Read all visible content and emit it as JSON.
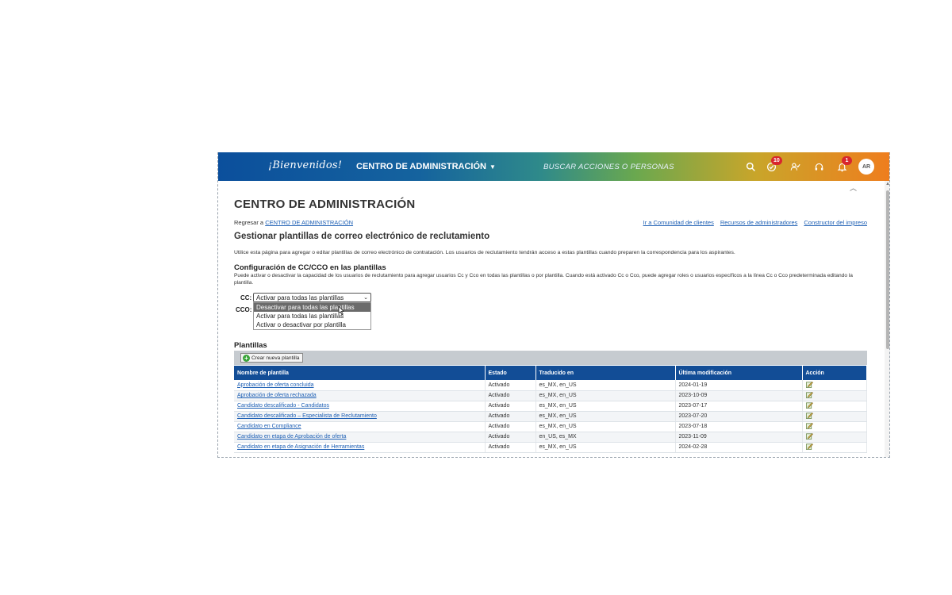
{
  "header": {
    "logo_text": "¡Bienvenidos!",
    "app_menu_label": "CENTRO DE ADMINISTRACIÓN",
    "search_placeholder": "BUSCAR ACCIONES O PERSONAS",
    "approvals_badge": "10",
    "notifications_badge": "1",
    "avatar_initials": "AR"
  },
  "page": {
    "title": "CENTRO DE ADMINISTRACIÓN",
    "back_prefix": "Regresar a",
    "back_link": "CENTRO DE ADMINISTRACIÓN",
    "right_links": [
      "Ir a Comunidad de clientes",
      "Recursos de administradores",
      "Constructor del impreso"
    ],
    "section_title": "Gestionar plantillas de correo electrónico de reclutamiento",
    "section_desc": "Utilice esta página para agregar o editar plantillas de correo electrónico de contratación. Los usuarios de reclutamiento tendrán acceso a estas plantillas cuando preparen la correspondencia para los aspirantes."
  },
  "cc_config": {
    "title": "Configuración de CC/CCO en las plantillas",
    "desc": "Puede activar o desactivar la capacidad de los usuarios de reclutamiento para agregar usuarios Cc y Cco en todas las plantillas o por plantilla. Cuando está activado Cc o Cco, puede agregar roles o usuarios específicos a la línea Cc o Cco predeterminada editando la plantilla.",
    "cc_label": "CC:",
    "cco_label": "CCO:",
    "cc_selected": "Activar para todas las plantillas",
    "options": [
      "Desactivar para todas las plantillas",
      "Activar para todas las plantillas",
      "Activar o desactivar por plantilla"
    ]
  },
  "templates": {
    "title": "Plantillas",
    "create_button": "Crear nueva plantilla",
    "columns": [
      "Nombre de plantilla",
      "Estado",
      "Traducido en",
      "Última modificación",
      "Acción"
    ],
    "rows": [
      {
        "name": "Aprobación de oferta concluida",
        "status": "Activado",
        "translated": "es_MX, en_US",
        "modified": "2024-01-19"
      },
      {
        "name": "Aprobación de oferta rechazada",
        "status": "Activado",
        "translated": "es_MX, en_US",
        "modified": "2023-10-09"
      },
      {
        "name": "Candidato descalificado - Candidatos",
        "status": "Activado",
        "translated": "es_MX, en_US",
        "modified": "2023-07-17"
      },
      {
        "name": "Candidato descalificado – Especialista de Reclutamiento",
        "status": "Activado",
        "translated": "es_MX, en_US",
        "modified": "2023-07-20"
      },
      {
        "name": "Candidato en Compliance",
        "status": "Activado",
        "translated": "es_MX, en_US",
        "modified": "2023-07-18"
      },
      {
        "name": "Candidato en etapa de Aprobación de oferta",
        "status": "Activado",
        "translated": "en_US, es_MX",
        "modified": "2023-11-09"
      },
      {
        "name": "Candidato en etapa de Asignación de Herramientas",
        "status": "Activado",
        "translated": "es_MX, en_US",
        "modified": "2024-02-28"
      }
    ]
  }
}
